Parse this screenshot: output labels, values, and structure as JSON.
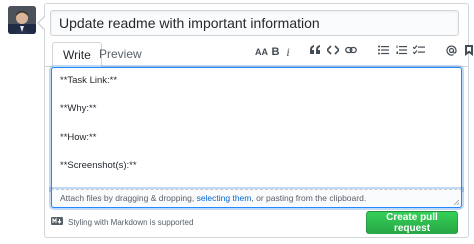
{
  "pr": {
    "title_value": "Update readme with important information"
  },
  "tabs": {
    "write": "Write",
    "preview": "Preview"
  },
  "toolbar": {
    "heading_label": "AA",
    "bold_label": "B",
    "italic_label": "i",
    "icons": [
      "heading-icon",
      "bold-icon",
      "italic-icon",
      "quote-icon",
      "code-icon",
      "link-icon",
      "unordered-list-icon",
      "ordered-list-icon",
      "task-list-icon",
      "mention-icon",
      "bookmark-icon",
      "reply-icon"
    ]
  },
  "editor": {
    "body": "**Task Link:**\n\n**Why:**\n\n**How:**\n\n**Screenshot(s):**"
  },
  "attach": {
    "prefix": "Attach files by dragging & dropping, ",
    "link": "selecting them",
    "suffix": ", or pasting from the clipboard."
  },
  "footer": {
    "markdown_note": "Styling with Markdown is supported",
    "submit_label": "Create pull request"
  },
  "colors": {
    "accent": "#0366d6",
    "submit": "#28a745",
    "focus_border": "#2188ff"
  }
}
